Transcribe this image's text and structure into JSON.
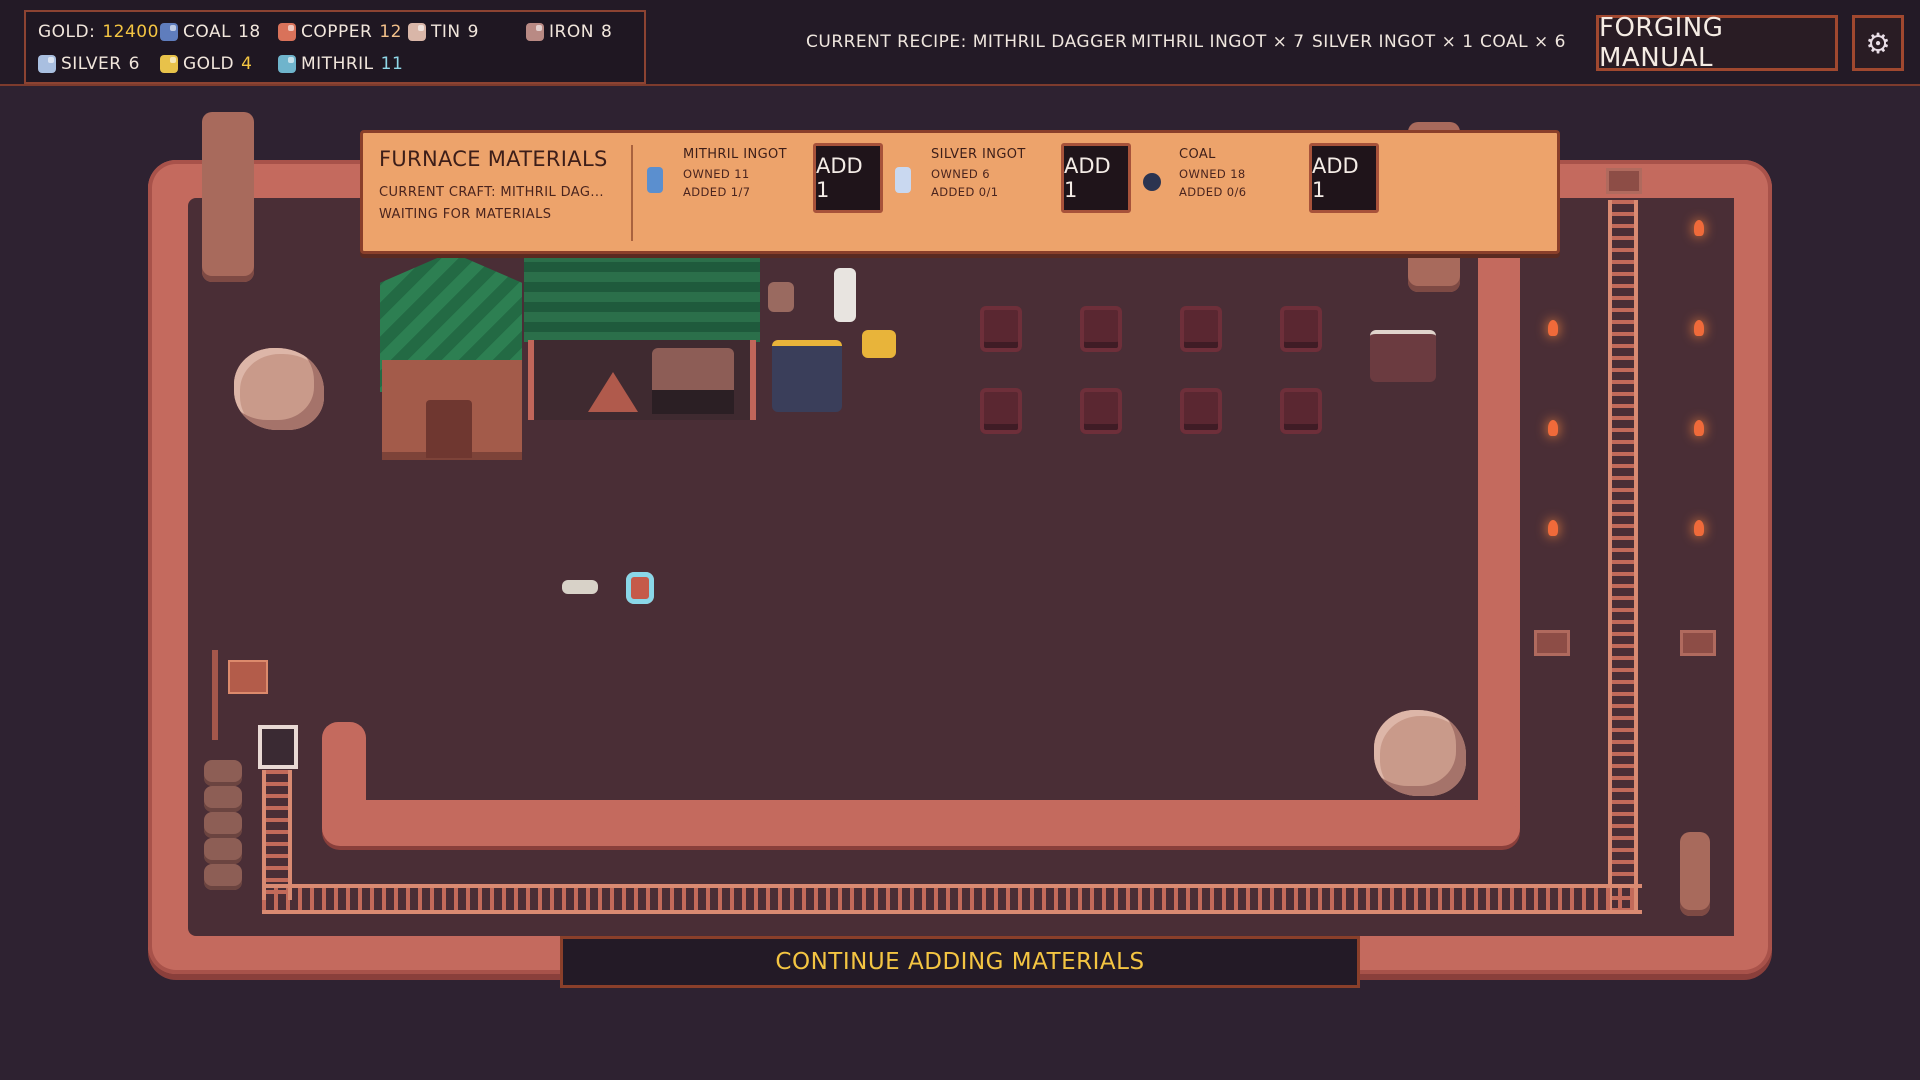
{
  "resources": [
    {
      "name": "GOLD:",
      "value": "12400",
      "icon": "gold-coin-icon",
      "color": "#f4c542",
      "style": "hl"
    },
    {
      "name": "COAL",
      "value": "18",
      "icon": "coal-ore-icon",
      "color": "#5f7dbd",
      "style": ""
    },
    {
      "name": "COPPER",
      "value": "12",
      "icon": "copper-ore-icon",
      "color": "#d9725a",
      "style": "cu"
    },
    {
      "name": "TIN",
      "value": "9",
      "icon": "tin-ore-icon",
      "color": "#d9b6a8",
      "style": ""
    },
    {
      "name": "IRON",
      "value": "8",
      "icon": "iron-ore-icon",
      "color": "#b98a84",
      "style": ""
    },
    {
      "name": "SILVER",
      "value": "6",
      "icon": "silver-ore-icon",
      "color": "#a9bfe0",
      "style": ""
    },
    {
      "name": "GOLD",
      "value": "4",
      "icon": "gold-ore-icon",
      "color": "#e8c24a",
      "style": "hl"
    },
    {
      "name": "MITHRIL",
      "value": "11",
      "icon": "mithril-ore-icon",
      "color": "#6fb4cc",
      "style": "bl"
    }
  ],
  "recipe": {
    "current": "CURRENT RECIPE: MITHRIL DAGGER",
    "req_mithril": "MITHRIL INGOT × 7",
    "req_silver": "SILVER INGOT × 1",
    "req_coal": "COAL × 6"
  },
  "buttons": {
    "manual": "FORGING MANUAL",
    "settings_icon": "gear-icon",
    "continue": "CONTINUE ADDING MATERIALS"
  },
  "furnace": {
    "title": "FURNACE MATERIALS",
    "current_craft": "CURRENT CRAFT: MITHRIL DAG...",
    "status": "WAITING FOR MATERIALS",
    "materials": [
      {
        "name": "MITHRIL INGOT",
        "owned": "OWNED 11",
        "added": "ADDED 1/7",
        "button": "ADD 1",
        "color": "#5b8fcf"
      },
      {
        "name": "SILVER INGOT",
        "owned": "OWNED 6",
        "added": "ADDED 0/1",
        "button": "ADD 1",
        "color": "#c9d8f0"
      },
      {
        "name": "COAL",
        "owned": "OWNED 18",
        "added": "ADDED 0/6",
        "button": "ADD 1",
        "color": "#2b3450"
      }
    ]
  }
}
